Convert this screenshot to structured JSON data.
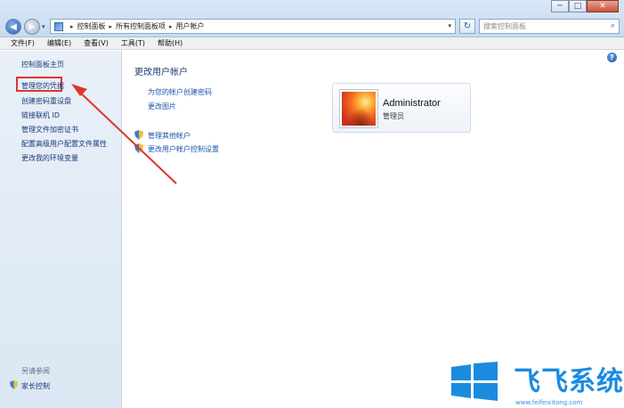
{
  "window": {
    "controls": {
      "minimize": "─",
      "maximize": "□",
      "close": "✕"
    }
  },
  "address": {
    "crumbs": [
      "控制面板",
      "所有控制面板项",
      "用户帐户"
    ],
    "refresh": "↻",
    "search_placeholder": "搜索控制面板"
  },
  "menu": {
    "items": [
      "文件(F)",
      "编辑(E)",
      "查看(V)",
      "工具(T)",
      "帮助(H)"
    ]
  },
  "sidebar": {
    "home": "控制面板主页",
    "links": [
      "管理您的凭据",
      "创建密码重设盘",
      "链接联机 ID",
      "管理文件加密证书",
      "配置高级用户配置文件属性",
      "更改我的环境变量"
    ],
    "see_also": "另请参阅",
    "parental": "家长控制"
  },
  "content": {
    "title": "更改用户帐户",
    "links": [
      "为您的帐户创建密码",
      "更改图片"
    ],
    "shield_links": [
      "管理其他帐户",
      "更改用户帐户控制设置"
    ],
    "account": {
      "name": "Administrator",
      "type": "管理员"
    }
  },
  "watermark": {
    "text": "飞飞系统",
    "url": "www.feifeixitong.com"
  },
  "colors": {
    "link": "#1a55a8",
    "highlight": "#e0342c",
    "watermark": "#1b8be0"
  }
}
